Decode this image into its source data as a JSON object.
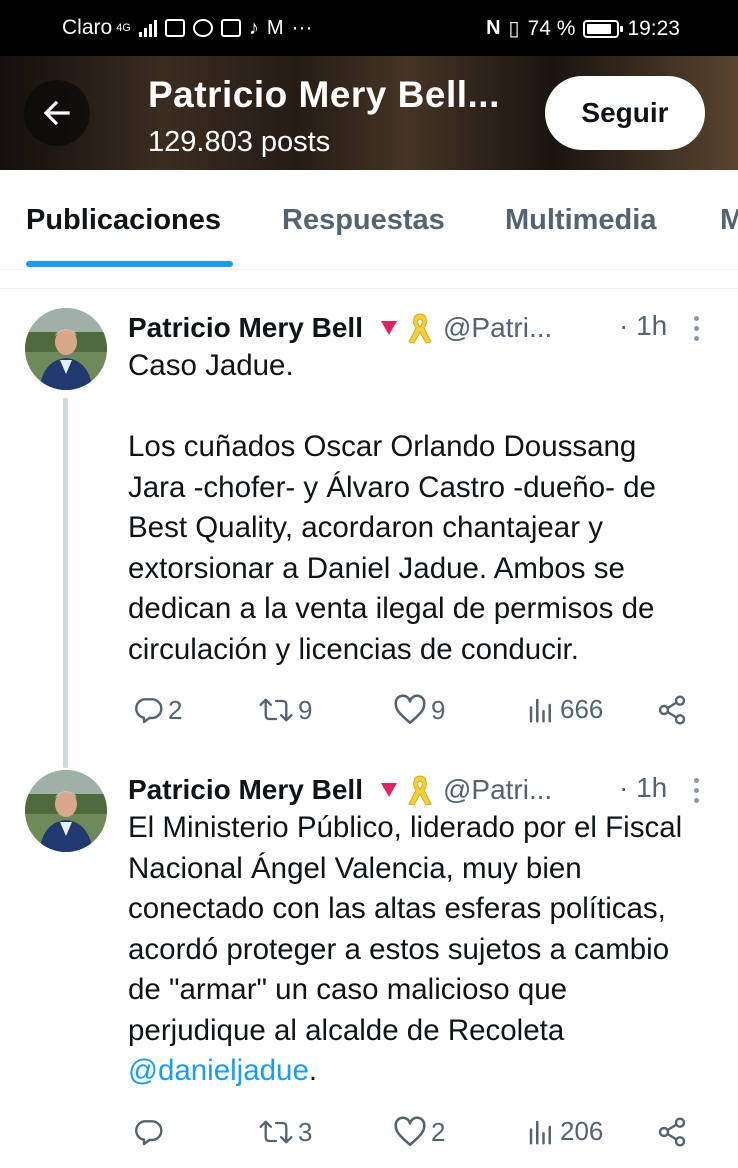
{
  "status_bar": {
    "carrier": "Claro",
    "network": "4G",
    "battery": "74 %",
    "time": "19:23"
  },
  "header": {
    "title": "Patricio Mery Bell...",
    "posts": "129.803 posts",
    "follow_label": "Seguir"
  },
  "tabs": [
    "Publicaciones",
    "Respuestas",
    "Multimedia",
    "M"
  ],
  "tweets": [
    {
      "name": "Patricio Mery Bell",
      "handle": "@Patri...",
      "time": "· 1h",
      "text_lines": [
        "Caso Jadue.",
        "",
        "Los cuñados Oscar Orlando Doussang",
        "Jara -chofer- y Álvaro Castro -dueño- de",
        "Best Quality, acordaron chantajear y",
        "extorsionar a Daniel Jadue. Ambos se",
        "dedican a la venta ilegal de permisos de",
        "circulación y licencias de conducir."
      ],
      "replies": "2",
      "retweets": "9",
      "likes": "9",
      "views": "666"
    },
    {
      "name": "Patricio Mery Bell",
      "handle": "@Patri...",
      "time": "· 1h",
      "text_lines": [
        "El Ministerio Público, liderado por el Fiscal",
        "Nacional Ángel Valencia, muy bien",
        "conectado con las altas esferas políticas,",
        "acordó  proteger a estos sujetos a cambio",
        "de \"armar\" un caso malicioso que",
        "perjudique al alcalde de Recoleta"
      ],
      "mention": "@danieljadue",
      "mention_suffix": ".",
      "replies": "",
      "retweets": "3",
      "likes": "2",
      "views": "206"
    }
  ],
  "colors": {
    "accent": "#1d9bf0",
    "text_primary": "#0f1419",
    "text_secondary": "#536471",
    "flag_red": "#e0245e",
    "ribbon_yellow": "#f4d03f"
  },
  "icons": [
    "back-arrow-icon",
    "reply-icon",
    "retweet-icon",
    "like-icon",
    "views-icon",
    "share-icon",
    "more-icon"
  ]
}
